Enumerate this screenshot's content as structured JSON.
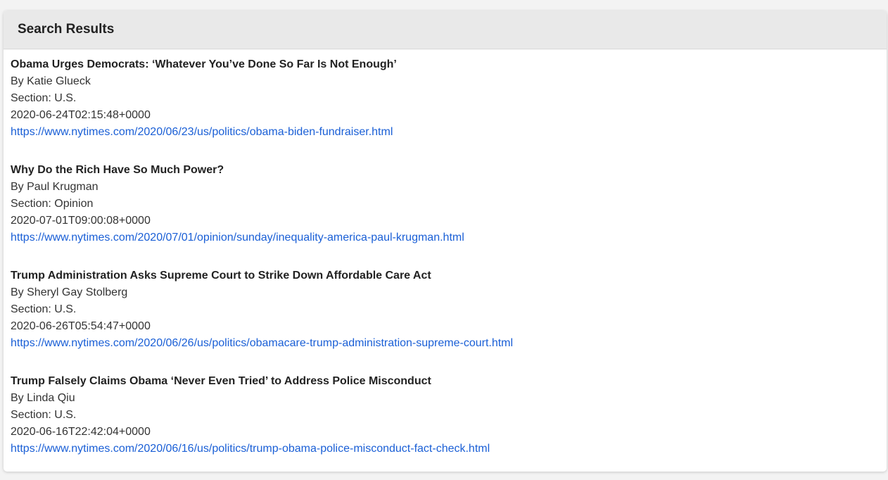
{
  "panel": {
    "title": "Search Results"
  },
  "results": [
    {
      "title": "Obama Urges Democrats: ‘Whatever You’ve Done So Far Is Not Enough’",
      "byline": "By Katie Glueck",
      "section": "Section: U.S.",
      "date": "2020-06-24T02:15:48+0000",
      "url": "https://www.nytimes.com/2020/06/23/us/politics/obama-biden-fundraiser.html"
    },
    {
      "title": "Why Do the Rich Have So Much Power?",
      "byline": "By Paul Krugman",
      "section": "Section: Opinion",
      "date": "2020-07-01T09:00:08+0000",
      "url": "https://www.nytimes.com/2020/07/01/opinion/sunday/inequality-america-paul-krugman.html"
    },
    {
      "title": "Trump Administration Asks Supreme Court to Strike Down Affordable Care Act",
      "byline": "By Sheryl Gay Stolberg",
      "section": "Section: U.S.",
      "date": "2020-06-26T05:54:47+0000",
      "url": "https://www.nytimes.com/2020/06/26/us/politics/obamacare-trump-administration-supreme-court.html"
    },
    {
      "title": "Trump Falsely Claims Obama ‘Never Even Tried’ to Address Police Misconduct",
      "byline": "By Linda Qiu",
      "section": "Section: U.S.",
      "date": "2020-06-16T22:42:04+0000",
      "url": "https://www.nytimes.com/2020/06/16/us/politics/trump-obama-police-misconduct-fact-check.html"
    }
  ],
  "colors": {
    "link": "#1a5fd6",
    "header_bg": "#e9e9e9"
  }
}
